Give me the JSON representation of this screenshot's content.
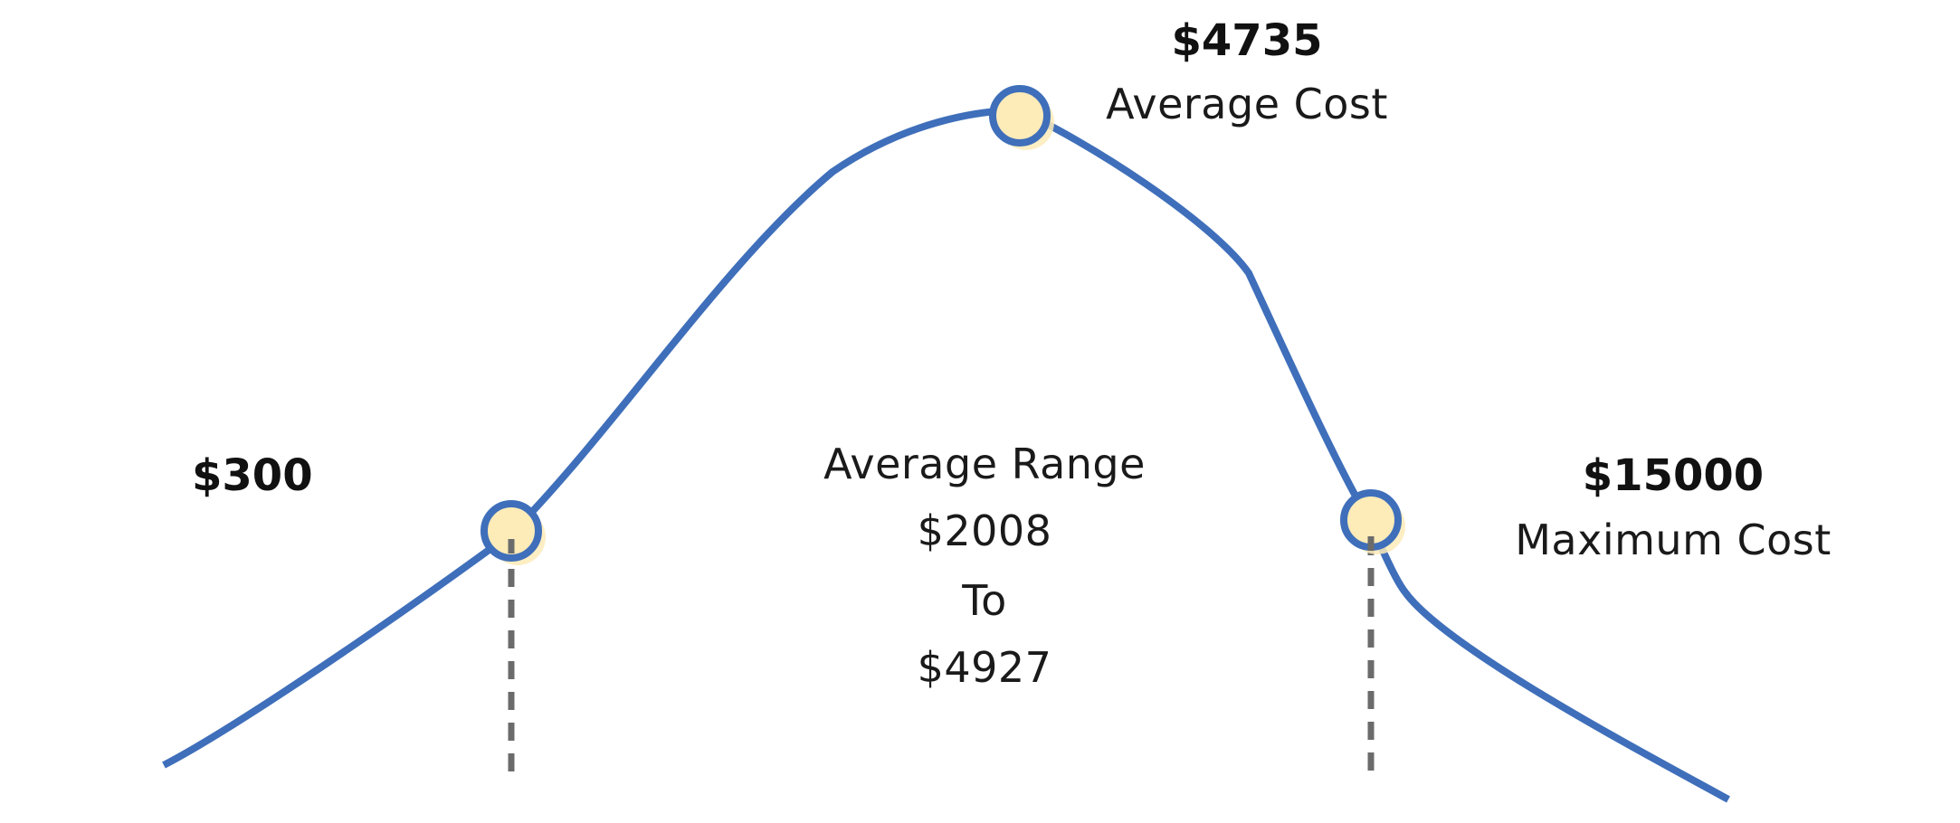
{
  "colors": {
    "curve": "#3f6fba",
    "marker_fill": "#fdebb8",
    "marker_ring": "#3f6fba",
    "dash": "#6b6b6b",
    "text": "#111111"
  },
  "minimum": {
    "value": "$300"
  },
  "average": {
    "value": "$4735",
    "caption": "Average Cost"
  },
  "maximum": {
    "value": "$15000",
    "caption": "Maximum Cost"
  },
  "range": {
    "title": "Average Range",
    "low": "$2008",
    "connector": "To",
    "high": "$4927"
  }
}
